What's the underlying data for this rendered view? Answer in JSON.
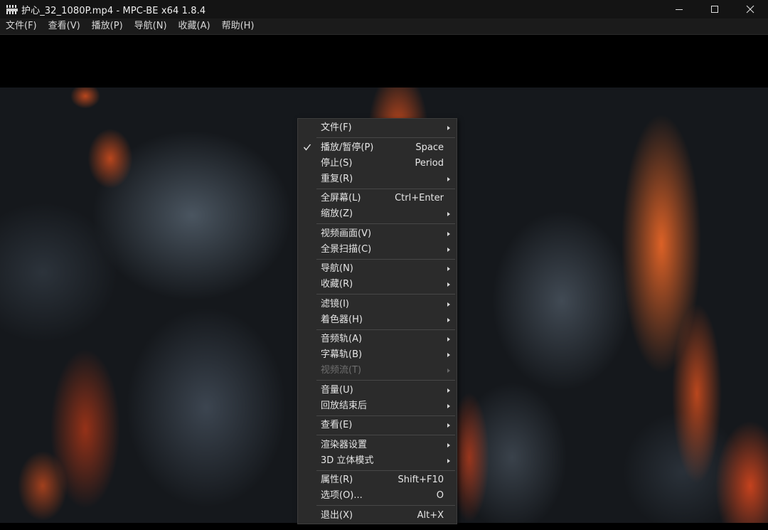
{
  "window": {
    "title": "护心_32_1080P.mp4 - MPC-BE x64 1.8.4",
    "app_icon": "film-clapper-icon"
  },
  "menubar": [
    "文件(F)",
    "查看(V)",
    "播放(P)",
    "导航(N)",
    "收藏(A)",
    "帮助(H)"
  ],
  "context_menu": {
    "groups": [
      [
        {
          "label": "文件(F)",
          "submenu": true
        }
      ],
      [
        {
          "label": "播放/暂停(P)",
          "shortcut": "Space",
          "checked": true
        },
        {
          "label": "停止(S)",
          "shortcut": "Period"
        },
        {
          "label": "重复(R)",
          "submenu": true
        }
      ],
      [
        {
          "label": "全屏幕(L)",
          "shortcut": "Ctrl+Enter"
        },
        {
          "label": "缩放(Z)",
          "submenu": true
        }
      ],
      [
        {
          "label": "视频画面(V)",
          "submenu": true
        },
        {
          "label": "全景扫描(C)",
          "submenu": true
        }
      ],
      [
        {
          "label": "导航(N)",
          "submenu": true
        },
        {
          "label": "收藏(R)",
          "submenu": true
        }
      ],
      [
        {
          "label": "滤镜(I)",
          "submenu": true
        },
        {
          "label": "着色器(H)",
          "submenu": true
        }
      ],
      [
        {
          "label": "音频轨(A)",
          "submenu": true
        },
        {
          "label": "字幕轨(B)",
          "submenu": true
        },
        {
          "label": "视频流(T)",
          "submenu": true,
          "disabled": true
        }
      ],
      [
        {
          "label": "音量(U)",
          "submenu": true
        },
        {
          "label": "回放结束后",
          "submenu": true
        }
      ],
      [
        {
          "label": "查看(E)",
          "submenu": true
        }
      ],
      [
        {
          "label": "渲染器设置",
          "submenu": true
        },
        {
          "label": "3D 立体模式",
          "submenu": true
        }
      ],
      [
        {
          "label": "属性(R)",
          "shortcut": "Shift+F10"
        },
        {
          "label": "选项(O)...",
          "shortcut": "O"
        }
      ],
      [
        {
          "label": "退出(X)",
          "shortcut": "Alt+X"
        }
      ]
    ]
  },
  "colors": {
    "menu_bg": "#2b2b2b",
    "menu_text": "#e6e6e6",
    "disabled_text": "#6f6f6f",
    "titlebar_bg": "#141414"
  }
}
